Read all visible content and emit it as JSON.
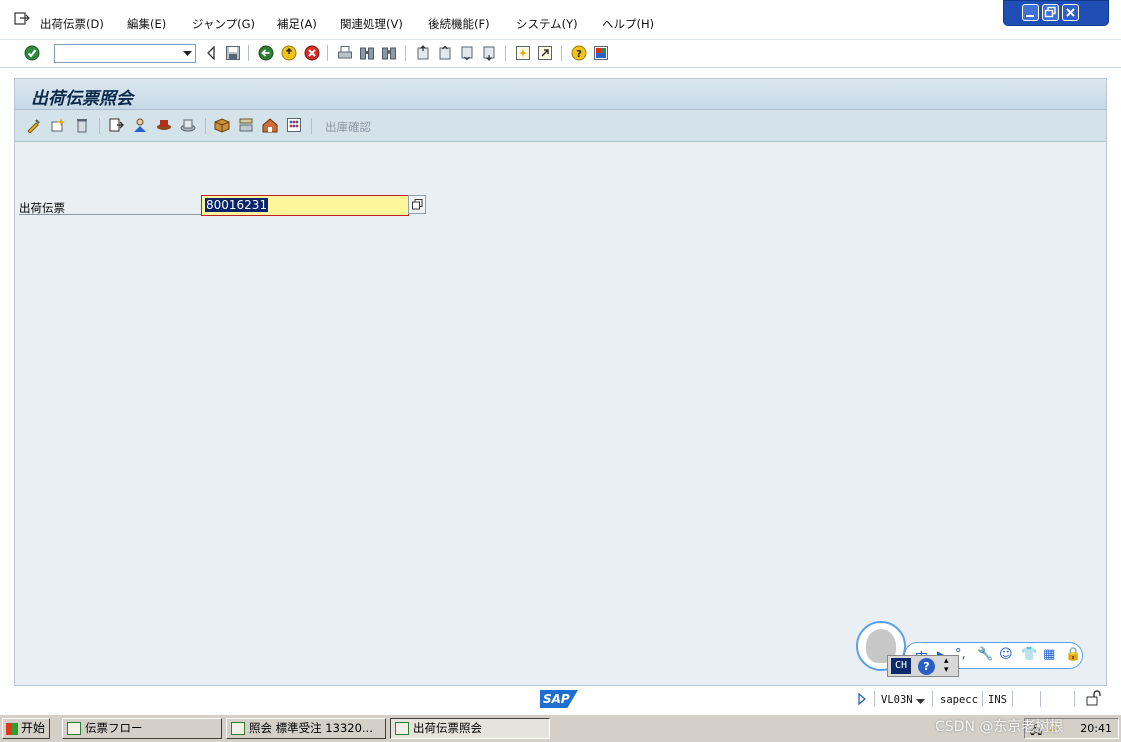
{
  "menu": {
    "items": [
      "出荷伝票(D)",
      "編集(E)",
      "ジャンプ(G)",
      "補足(A)",
      "関連処理(V)",
      "後続機能(F)",
      "システム(Y)",
      "ヘルプ(H)"
    ]
  },
  "window_controls": [
    "minimize",
    "restore",
    "close"
  ],
  "command_field": {
    "value": ""
  },
  "screen": {
    "title": "出荷伝票照会",
    "app_toolbar": {
      "disabled_button": "出庫確認"
    },
    "field": {
      "label": "出荷伝票",
      "value": "80016231"
    }
  },
  "ime": {
    "mode": "CH",
    "help": "?"
  },
  "status": {
    "logo": "SAP",
    "transaction": "VL03N",
    "server": "sapecc",
    "mode": "INS"
  },
  "taskbar": {
    "start": "开始",
    "tasks": [
      "伝票フロー",
      "照会 標準受注 13320...",
      "出荷伝票照会"
    ],
    "clock": "20:41"
  },
  "watermark": "CSDN @东京老树根",
  "colors": {
    "input_highlight": "#fff69b",
    "frame_bg": "#e9eff3",
    "title_text": "#0b2a4a"
  }
}
